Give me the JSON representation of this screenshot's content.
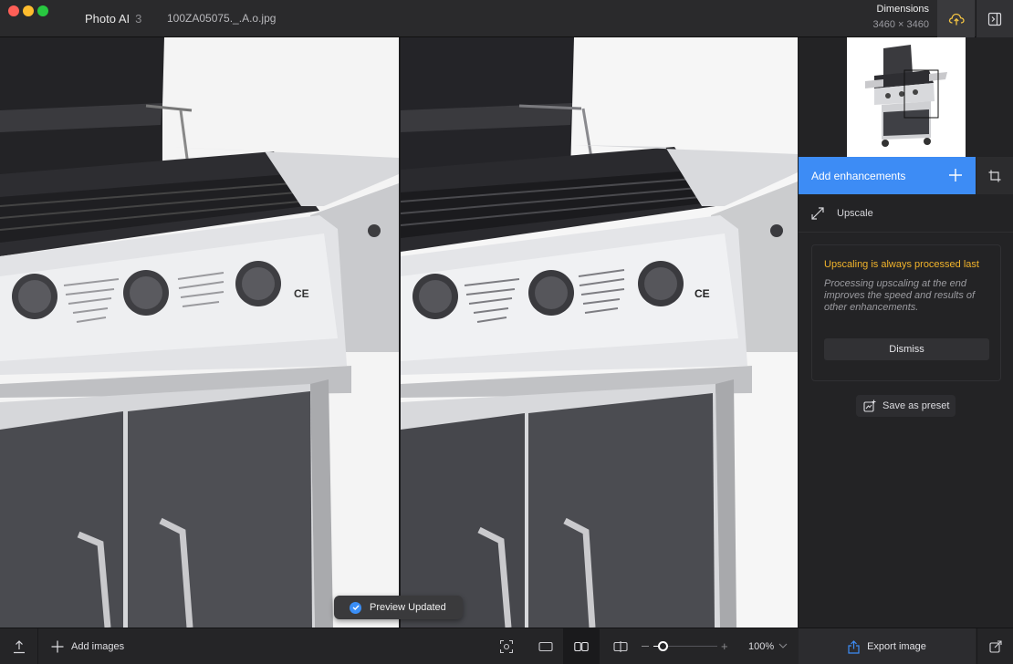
{
  "app": {
    "name": "Photo AI",
    "version": "3",
    "file_name": "100ZA05075._.A.o.jpg"
  },
  "dimensions": {
    "label": "Dimensions",
    "value": "3460 × 3460"
  },
  "icons": {
    "cloud": "cloud-upload-icon",
    "panel": "sidebar-toggle-icon",
    "plus": "plus-icon",
    "crop": "crop-icon",
    "upscale": "expand-arrows-icon",
    "preset": "save-preset-icon",
    "upload": "upload-icon",
    "check": "check-circle-icon",
    "screenshot": "screenshot-icon",
    "single_view": "single-view-icon",
    "side_by_side": "side-by-side-icon",
    "split_view": "split-view-icon",
    "export": "export-icon",
    "share": "share-icon"
  },
  "colors": {
    "accent": "#3d8cf5",
    "warning": "#f2b42b",
    "cloud_icon": "#f5c542"
  },
  "toast": {
    "text": "Preview Updated"
  },
  "panel": {
    "add_enhancements": "Add enhancements",
    "upscale_label": "Upscale",
    "notice": {
      "title": "Upscaling is always processed last",
      "body": "Processing upscaling at the end improves the speed and results of other enhancements.",
      "dismiss": "Dismiss"
    },
    "save_preset": "Save as preset"
  },
  "bottombar": {
    "add_images": "Add images",
    "zoom_level": 0.14,
    "zoom_value": "100%",
    "export": "Export image"
  }
}
